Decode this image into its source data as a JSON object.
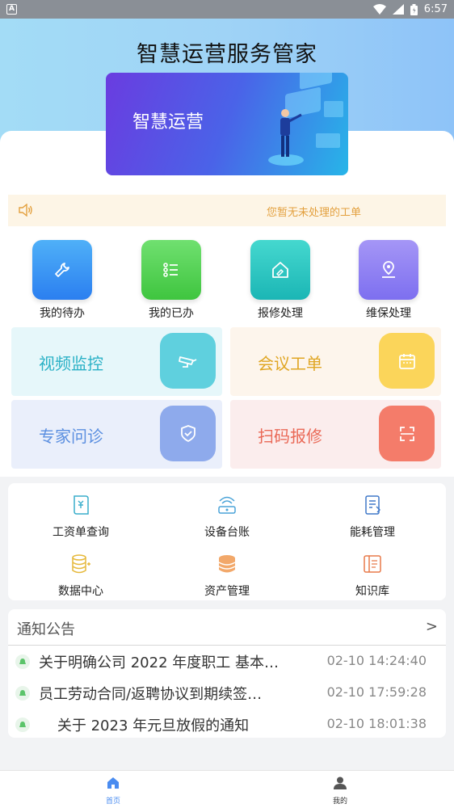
{
  "status_bar": {
    "time": "6:57",
    "app_badge": "A"
  },
  "header": {
    "title": "智慧运营服务管家"
  },
  "banner": {
    "text": "智慧运营"
  },
  "notice": {
    "text": "您暂无未处理的工单"
  },
  "quick_actions": [
    {
      "label": "我的待办",
      "icon": "wrench-icon",
      "color": "#2f8ef0"
    },
    {
      "label": "我的已办",
      "icon": "list-icon",
      "color": "#4ccf4c"
    },
    {
      "label": "报修处理",
      "icon": "house-repair-icon",
      "color": "#23c4bf"
    },
    {
      "label": "维保处理",
      "icon": "location-pin-icon",
      "color": "#8b7bf0"
    }
  ],
  "cards": [
    {
      "label": "视频监控",
      "icon": "camera-icon",
      "text_color": "#2ab1c6",
      "bg": "#e8f8fb",
      "icon_bg": "#5fd0de"
    },
    {
      "label": "会议工单",
      "icon": "calendar-icon",
      "text_color": "#e0a624",
      "bg": "#fdf6ee",
      "icon_bg": "#fbd55a"
    },
    {
      "label": "专家问诊",
      "icon": "shield-check-icon",
      "text_color": "#5b8fe0",
      "bg": "#ebf0fb",
      "icon_bg": "#8eaaec"
    },
    {
      "label": "扫码报修",
      "icon": "scan-icon",
      "text_color": "#ea6a58",
      "bg": "#fcefee",
      "icon_bg": "#f47c6a"
    }
  ],
  "services": [
    {
      "label": "工资单查询",
      "icon": "salary-doc-icon"
    },
    {
      "label": "设备台账",
      "icon": "router-icon"
    },
    {
      "label": "能耗管理",
      "icon": "energy-doc-icon"
    },
    {
      "label": "数据中心",
      "icon": "database-icon"
    },
    {
      "label": "资产管理",
      "icon": "coins-icon"
    },
    {
      "label": "知识库",
      "icon": "book-icon"
    }
  ],
  "news": {
    "title": "通知公告",
    "more": ">",
    "items": [
      {
        "text": "关于明确公司 2022 年度职工 基本…",
        "date": "02-10 14:24:40"
      },
      {
        "text": "员工劳动合同/返聘协议到期续签…",
        "date": "02-10 17:59:28"
      },
      {
        "text": "    关于 2023 年元旦放假的通知",
        "date": "02-10 18:01:38"
      }
    ]
  },
  "tabbar": {
    "items": [
      {
        "label": "首页",
        "icon": "home-icon",
        "active": true
      },
      {
        "label": "我的",
        "icon": "user-icon",
        "active": false
      }
    ]
  },
  "colors": {
    "active_tab": "#4a8cf0",
    "inactive_tab": "#333333"
  }
}
